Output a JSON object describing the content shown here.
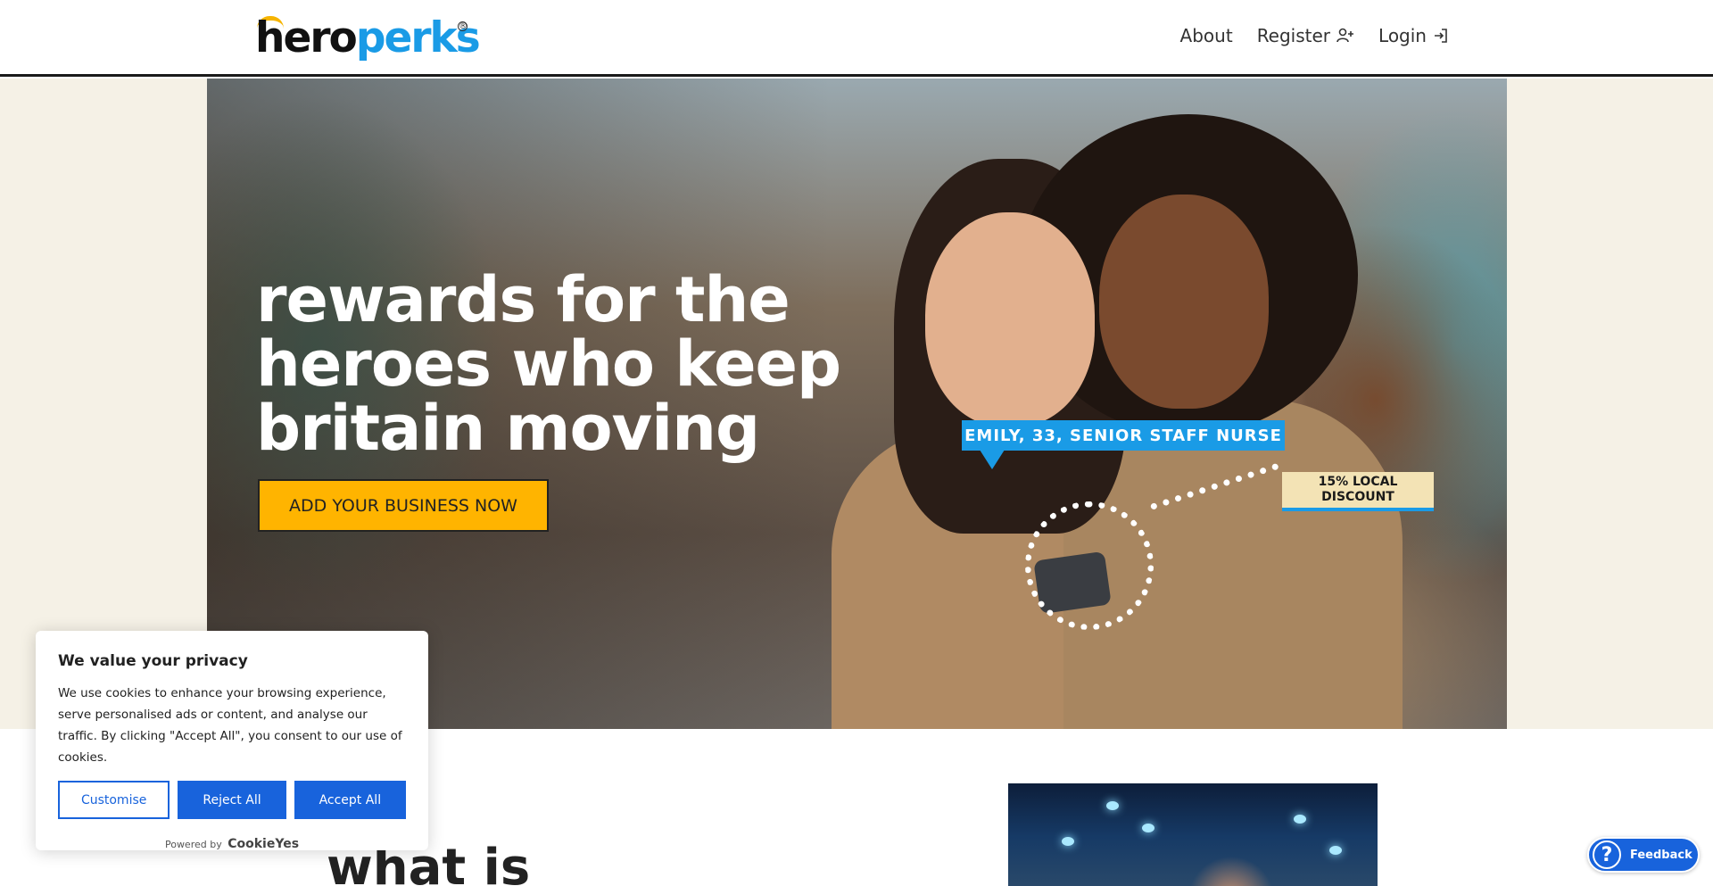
{
  "header": {
    "logo": {
      "part1": "hero",
      "part2": "perks",
      "registered": "®"
    },
    "nav": [
      {
        "label": "About",
        "icon": ""
      },
      {
        "label": "Register",
        "icon": "user-plus-icon"
      },
      {
        "label": "Login",
        "icon": "login-icon"
      }
    ]
  },
  "hero": {
    "title": "rewards for the heroes who keep britain moving",
    "cta_label": "ADD YOUR BUSINESS NOW",
    "tag_person": "EMILY, 33, SENIOR STAFF NURSE",
    "tag_discount": "15% LOCAL DISCOUNT"
  },
  "section": {
    "title": "what is"
  },
  "cookie": {
    "title": "We value your privacy",
    "text": "We use cookies to enhance your browsing experience, serve personalised ads or content, and analyse our traffic. By clicking \"Accept All\", you consent to our use of cookies.",
    "customise_label": "Customise",
    "reject_label": "Reject All",
    "accept_label": "Accept All",
    "powered_by": "Powered by",
    "powered_brand": "CookieYes"
  },
  "feedback": {
    "label": "Feedback",
    "icon": "question-icon"
  },
  "colors": {
    "brand_blue": "#1a9be6",
    "accent_yellow": "#ffb400",
    "cookie_blue": "#1863dc"
  }
}
